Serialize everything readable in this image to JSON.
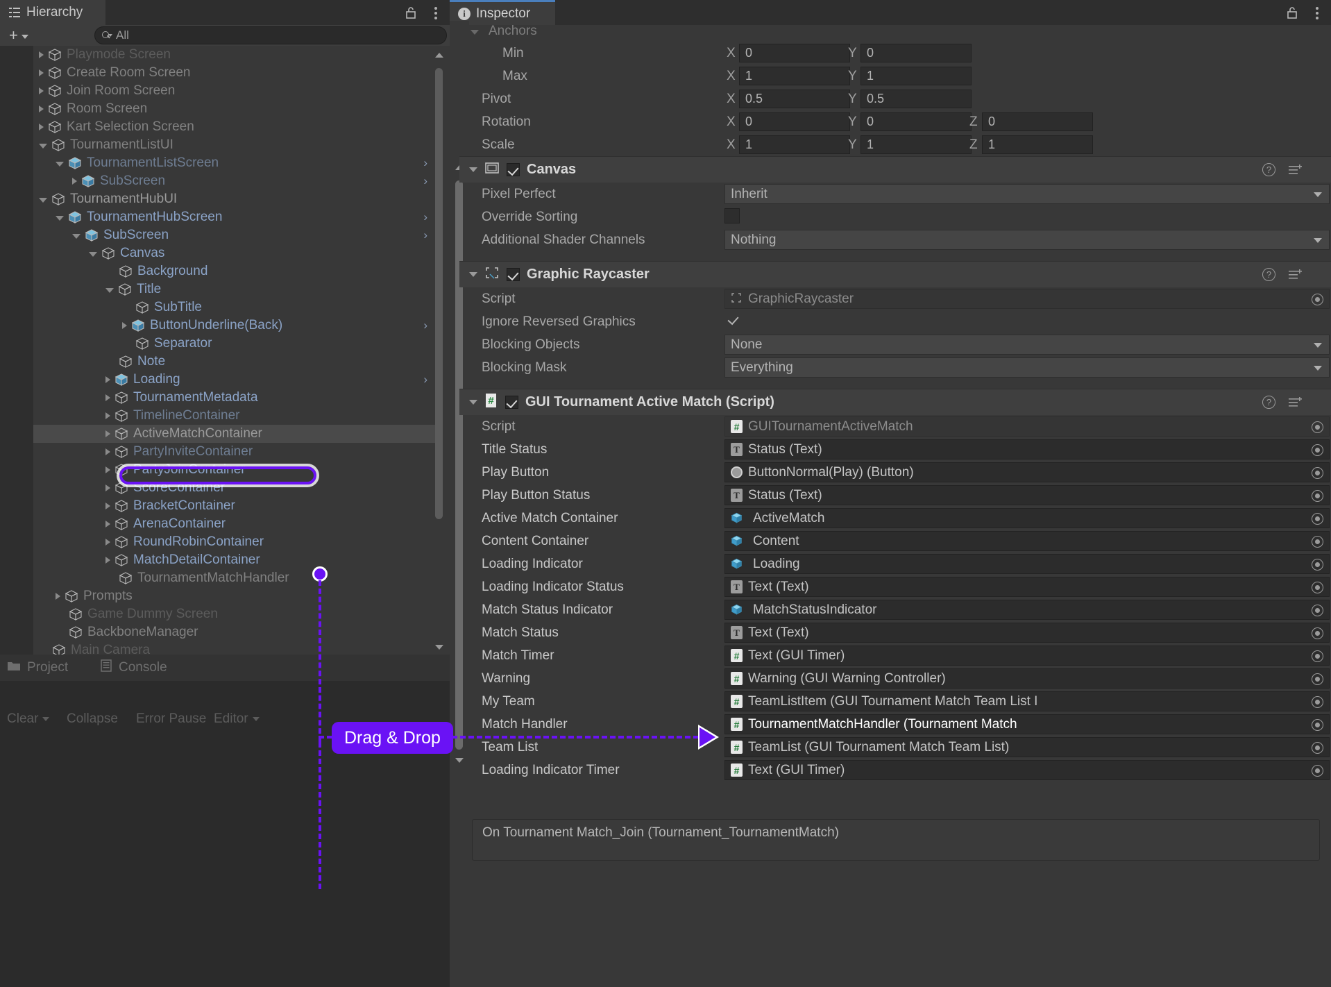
{
  "hierarchy": {
    "tab_label": "Hierarchy",
    "tab_icon": "hierarchy-icon",
    "add_label": "+",
    "search": {
      "placeholder": "All",
      "value": "All",
      "icon": "search-icon"
    },
    "lock_icon": "lock-icon",
    "menu_icon": "kebab-menu-icon",
    "rows": [
      {
        "label": "Playmode Screen",
        "indent": 1,
        "tw": "closed",
        "cube": "grey",
        "tone": "faint"
      },
      {
        "label": "Create Room Screen",
        "indent": 1,
        "tw": "closed",
        "cube": "grey",
        "tone": "grey2"
      },
      {
        "label": "Join Room Screen",
        "indent": 1,
        "tw": "closed",
        "cube": "grey",
        "tone": "grey2"
      },
      {
        "label": "Room Screen",
        "indent": 1,
        "tw": "closed",
        "cube": "grey",
        "tone": "grey2"
      },
      {
        "label": "Kart Selection Screen",
        "indent": 1,
        "tw": "closed",
        "cube": "grey",
        "tone": "grey2"
      },
      {
        "label": "TournamentListUI",
        "indent": 1,
        "tw": "open",
        "cube": "grey",
        "tone": "grey2"
      },
      {
        "label": "TournamentListScreen",
        "indent": 2,
        "tw": "open",
        "cube": "blue",
        "tone": "dim",
        "chevron": true
      },
      {
        "label": "SubScreen",
        "indent": 3,
        "tw": "closed",
        "cube": "blue",
        "tone": "dim",
        "chevron": true
      },
      {
        "label": "TournamentHubUI",
        "indent": 1,
        "tw": "open",
        "cube": "grey",
        "tone": "grey"
      },
      {
        "label": "TournamentHubScreen",
        "indent": 2,
        "tw": "open",
        "cube": "blue",
        "tone": "blue",
        "chevron": true
      },
      {
        "label": "SubScreen",
        "indent": 3,
        "tw": "open",
        "cube": "blue",
        "tone": "blue",
        "chevron": true
      },
      {
        "label": "Canvas",
        "indent": 4,
        "tw": "open",
        "cube": "grey",
        "tone": "blue"
      },
      {
        "label": "Background",
        "indent": 5,
        "tw": "none",
        "cube": "grey",
        "tone": "blue"
      },
      {
        "label": "Title",
        "indent": 5,
        "tw": "open",
        "cube": "grey",
        "tone": "blue"
      },
      {
        "label": "SubTitle",
        "indent": 6,
        "tw": "none",
        "cube": "grey",
        "tone": "blue"
      },
      {
        "label": "ButtonUnderline(Back)",
        "indent": 6,
        "tw": "closed",
        "cube": "blue",
        "tone": "blue",
        "chevron": true
      },
      {
        "label": "Separator",
        "indent": 6,
        "tw": "none",
        "cube": "grey",
        "tone": "blue"
      },
      {
        "label": "Note",
        "indent": 5,
        "tw": "none",
        "cube": "grey",
        "tone": "blue"
      },
      {
        "label": "Loading",
        "indent": 5,
        "tw": "closed",
        "cube": "blue",
        "tone": "blue",
        "chevron": true
      },
      {
        "label": "TournamentMetadata",
        "indent": 5,
        "tw": "closed",
        "cube": "grey",
        "tone": "blue"
      },
      {
        "label": "TimelineContainer",
        "indent": 5,
        "tw": "closed",
        "cube": "grey",
        "tone": "dim"
      },
      {
        "label": "ActiveMatchContainer",
        "indent": 5,
        "tw": "closed",
        "cube": "grey",
        "tone": "grey",
        "selected": true
      },
      {
        "label": "PartyInviteContainer",
        "indent": 5,
        "tw": "closed",
        "cube": "grey",
        "tone": "dim"
      },
      {
        "label": "PartyJoinContainer",
        "indent": 5,
        "tw": "closed",
        "cube": "grey",
        "tone": "blue"
      },
      {
        "label": "ScoreContainer",
        "indent": 5,
        "tw": "closed",
        "cube": "grey",
        "tone": "blue"
      },
      {
        "label": "BracketContainer",
        "indent": 5,
        "tw": "closed",
        "cube": "grey",
        "tone": "blue"
      },
      {
        "label": "ArenaContainer",
        "indent": 5,
        "tw": "closed",
        "cube": "grey",
        "tone": "blue"
      },
      {
        "label": "RoundRobinContainer",
        "indent": 5,
        "tw": "closed",
        "cube": "grey",
        "tone": "blue"
      },
      {
        "label": "MatchDetailContainer",
        "indent": 5,
        "tw": "closed",
        "cube": "grey",
        "tone": "blue"
      },
      {
        "label": "TournamentMatchHandler",
        "indent": 5,
        "tw": "none",
        "cube": "grey",
        "tone": "grey2"
      },
      {
        "label": "Prompts",
        "indent": 2,
        "tw": "closed",
        "cube": "grey",
        "tone": "grey2"
      },
      {
        "label": "Game Dummy Screen",
        "indent": 2,
        "tw": "none",
        "cube": "grey",
        "tone": "faint"
      },
      {
        "label": "BackboneManager",
        "indent": 2,
        "tw": "none",
        "cube": "grey",
        "tone": "grey2"
      },
      {
        "label": "Main Camera",
        "indent": 1,
        "tw": "none",
        "cube": "grey",
        "tone": "faint"
      }
    ]
  },
  "bottom_dock": {
    "tabs": [
      {
        "label": "Project",
        "icon": "folder-icon"
      },
      {
        "label": "Console",
        "icon": "console-icon"
      }
    ],
    "toolbar": [
      {
        "label": "Clear",
        "caret": true
      },
      {
        "label": "Collapse",
        "caret": false
      },
      {
        "label": "Error Pause",
        "caret": false
      },
      {
        "label": "Editor",
        "caret": true
      }
    ]
  },
  "inspector": {
    "tab_label": "Inspector",
    "tab_icon": "info-icon",
    "lock_icon": "lock-icon",
    "menu_icon": "kebab-menu-icon",
    "rect_transform": {
      "anchors_label": "Anchors",
      "rows": [
        {
          "label": "Min",
          "indent": true,
          "fields": [
            {
              "axis": "X",
              "value": "0"
            },
            {
              "axis": "Y",
              "value": "0"
            }
          ]
        },
        {
          "label": "Max",
          "indent": true,
          "fields": [
            {
              "axis": "X",
              "value": "1"
            },
            {
              "axis": "Y",
              "value": "1"
            }
          ]
        },
        {
          "label": "Pivot",
          "indent": false,
          "fields": [
            {
              "axis": "X",
              "value": "0.5"
            },
            {
              "axis": "Y",
              "value": "0.5"
            }
          ]
        },
        {
          "label": "Rotation",
          "indent": false,
          "fields": [
            {
              "axis": "X",
              "value": "0"
            },
            {
              "axis": "Y",
              "value": "0"
            },
            {
              "axis": "Z",
              "value": "0"
            }
          ]
        },
        {
          "label": "Scale",
          "indent": false,
          "fields": [
            {
              "axis": "X",
              "value": "1"
            },
            {
              "axis": "Y",
              "value": "1"
            },
            {
              "axis": "Z",
              "value": "1"
            }
          ]
        }
      ]
    },
    "canvas": {
      "title": "Canvas",
      "icon": "canvas-icon",
      "enabled": true,
      "rows": [
        {
          "label": "Pixel Perfect",
          "type": "dropdown",
          "value": "Inherit"
        },
        {
          "label": "Override Sorting",
          "type": "checkbox",
          "value": false
        },
        {
          "label": "Additional Shader Channels",
          "type": "dropdown",
          "value": "Nothing"
        }
      ]
    },
    "graphic_raycaster": {
      "title": "Graphic Raycaster",
      "icon": "raycaster-icon",
      "enabled": true,
      "rows": [
        {
          "label": "Script",
          "type": "object-readonly",
          "value": "GraphicRaycaster",
          "icon": "raycaster-mini-icon"
        },
        {
          "label": "Ignore Reversed Graphics",
          "type": "checkbox-bare",
          "value": true
        },
        {
          "label": "Blocking Objects",
          "type": "dropdown",
          "value": "None"
        },
        {
          "label": "Blocking Mask",
          "type": "dropdown",
          "value": "Everything"
        }
      ]
    },
    "script_component": {
      "title": "GUI Tournament Active Match (Script)",
      "icon": "cs-script-icon",
      "enabled": true,
      "rows": [
        {
          "label": "Script",
          "value": "GUITournamentActiveMatch",
          "icon": "script-icon",
          "readonly": true
        },
        {
          "label": "Title Status",
          "value": "Status (Text)",
          "icon": "text-icon"
        },
        {
          "label": "Play Button",
          "value": "ButtonNormal(Play) (Button)",
          "icon": "button-icon"
        },
        {
          "label": "Play Button Status",
          "value": "Status (Text)",
          "icon": "text-icon"
        },
        {
          "label": "Active Match Container",
          "value": "ActiveMatch",
          "icon": "prefab-icon"
        },
        {
          "label": "Content Container",
          "value": "Content",
          "icon": "prefab-icon"
        },
        {
          "label": "Loading Indicator",
          "value": "Loading",
          "icon": "prefab-icon"
        },
        {
          "label": "Loading Indicator Status",
          "value": "Text (Text)",
          "icon": "text-icon"
        },
        {
          "label": "Match Status Indicator",
          "value": "MatchStatusIndicator",
          "icon": "prefab-icon"
        },
        {
          "label": "Match Status",
          "value": "Text (Text)",
          "icon": "text-icon"
        },
        {
          "label": "Match Timer",
          "value": "Text (GUI Timer)",
          "icon": "script-icon"
        },
        {
          "label": "Warning",
          "value": "Warning (GUI Warning Controller)",
          "icon": "script-icon"
        },
        {
          "label": "My Team",
          "value": "TeamListItem (GUI Tournament Match Team List I",
          "icon": "script-icon"
        },
        {
          "label": "Match Handler",
          "value": "TournamentMatchHandler (Tournament Match",
          "icon": "script-icon",
          "highlight": true
        },
        {
          "label": "Team List",
          "value": "TeamList (GUI Tournament Match Team List)",
          "icon": "script-icon"
        },
        {
          "label": "Loading Indicator Timer",
          "value": "Text (GUI Timer)",
          "icon": "script-icon"
        }
      ],
      "event_header": "On Tournament Match_Join (Tournament_TournamentMatch)"
    }
  },
  "annotation": {
    "badge_label": "Drag & Drop",
    "accent_color": "#6a12f5",
    "source": "ActiveMatchContainer",
    "target": "Match Handler"
  }
}
